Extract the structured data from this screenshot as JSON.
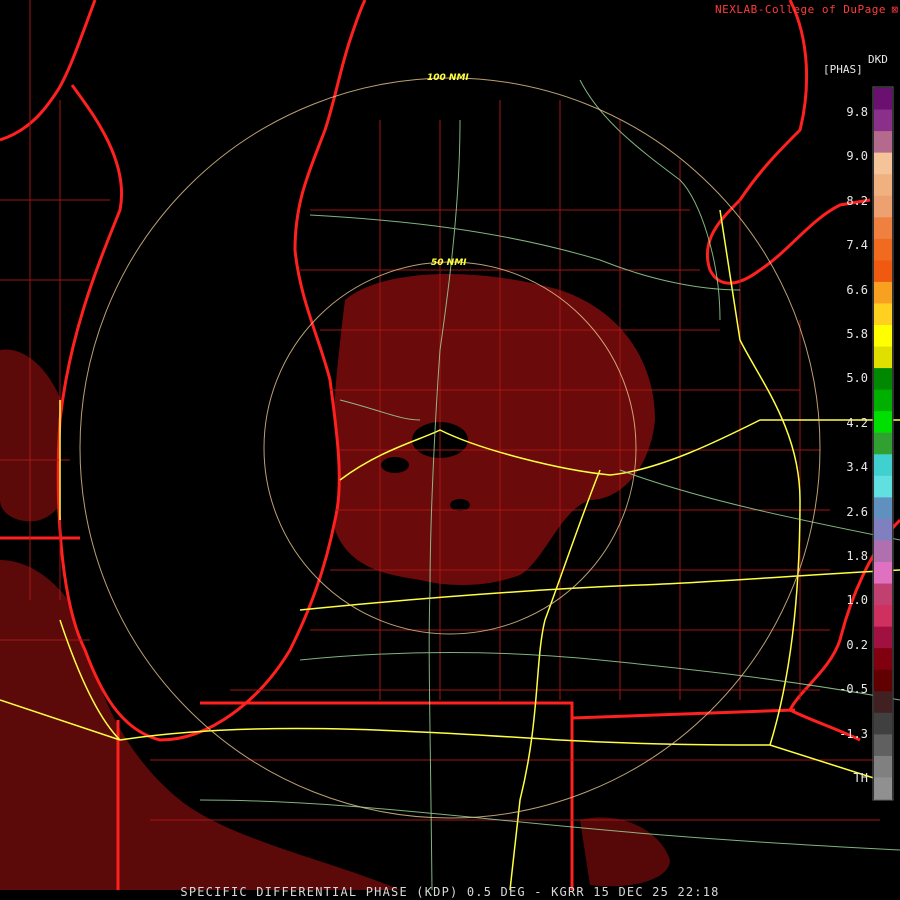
{
  "header": {
    "credit": "NEXLAB-College of DuPage",
    "credit_mark": "⊠"
  },
  "colorbar": {
    "units_code": "DKD",
    "units_name": "[PHAS]",
    "labels": [
      "9.8",
      "9.0",
      "8.2",
      "7.4",
      "6.6",
      "5.8",
      "5.0",
      "4.2",
      "3.4",
      "2.6",
      "1.8",
      "1.0",
      "0.2",
      "-0.5",
      "-1.3",
      "TH"
    ],
    "colors": [
      "#6a1070",
      "#8a2f8a",
      "#b46a8c",
      "#f5c39a",
      "#f0b080",
      "#eda070",
      "#f08040",
      "#f06a20",
      "#f05a10",
      "#f8a020",
      "#ffd020",
      "#ffff00",
      "#e0e000",
      "#008800",
      "#00b000",
      "#00e000",
      "#30a030",
      "#40d0d0",
      "#60e0e0",
      "#6090c0",
      "#8080c0",
      "#b070b0",
      "#e070c0",
      "#c04070",
      "#d03060",
      "#a01040",
      "#800010",
      "#600000",
      "#402020",
      "#404040",
      "#606060",
      "#808080",
      "#909090"
    ]
  },
  "range_rings": {
    "inner": "50 NMI",
    "outer": "100 NMI"
  },
  "footer": {
    "product": "SPECIFIC DIFFERENTIAL PHASE (KDP) 0.5 DEG - KGRR 15 DEC 25 22:18"
  }
}
